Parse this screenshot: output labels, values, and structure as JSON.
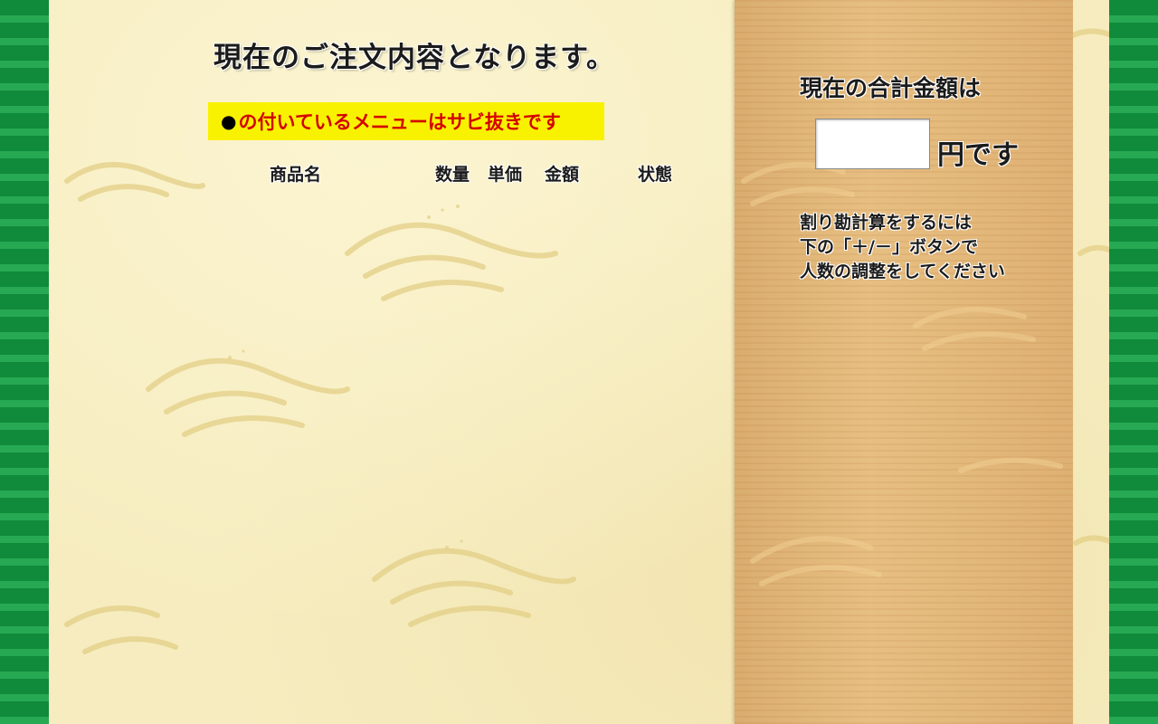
{
  "order": {
    "heading": "現在のご注文内容となります。",
    "notice_bullet": "●",
    "notice_text": "の付いているメニューはサビ抜きです",
    "columns": {
      "name": "商品名",
      "quantity": "数量",
      "unit_price": "単価",
      "amount": "金額",
      "status": "状態"
    },
    "items": []
  },
  "summary": {
    "total_label": "現在の合計金額は",
    "total_value": "",
    "yen_suffix": "円です",
    "split_note": [
      "割り勘計算をするには",
      "下の「＋/－」ボタンで",
      "人数の調整をしてください"
    ]
  },
  "colors": {
    "stripe_dark": "#108a3b",
    "stripe_light": "#27a953",
    "paper": "#f6ecbf",
    "wood": "#e0b578",
    "notice_bg": "#f8f200",
    "notice_text": "#d40000"
  }
}
